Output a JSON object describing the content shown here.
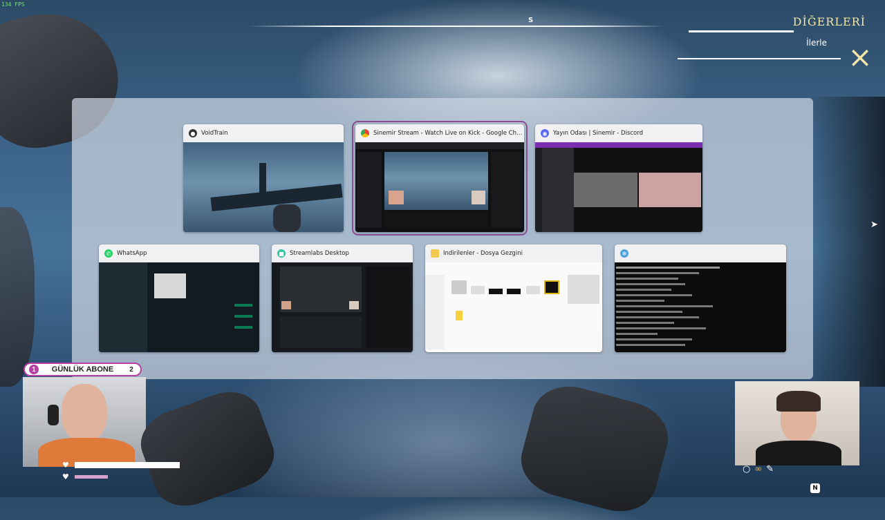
{
  "hud": {
    "fps": "134 FPS",
    "compass_dir": "S",
    "objective_title": "DİĞERLERİ",
    "objective_sub": "İlerle",
    "abone_left": "1",
    "abone_label": "GÜNLÜK ABONE",
    "abone_right": "2",
    "n_key": "N"
  },
  "switcher": {
    "windows": [
      {
        "title": "VoidTrain",
        "icon": "voidtrain-icon",
        "selected": false
      },
      {
        "title": "Sinemir Stream - Watch Live on Kick - Google Chrome",
        "icon": "chrome-icon",
        "selected": true
      },
      {
        "title": "Yayın Odası | Sinemir - Discord",
        "icon": "discord-icon",
        "selected": false
      },
      {
        "title": "WhatsApp",
        "icon": "whatsapp-icon",
        "selected": false
      },
      {
        "title": "Streamlabs Desktop",
        "icon": "streamlabs-icon",
        "selected": false
      },
      {
        "title": "İndirilenler - Dosya Gezgini",
        "icon": "folder-icon",
        "selected": false
      },
      {
        "title": "",
        "icon": "terminal-icon",
        "selected": false
      }
    ]
  },
  "colors": {
    "selection": "#8a4d92",
    "abone_accent": "#b63fa3",
    "objective": "#f3e6a8"
  }
}
